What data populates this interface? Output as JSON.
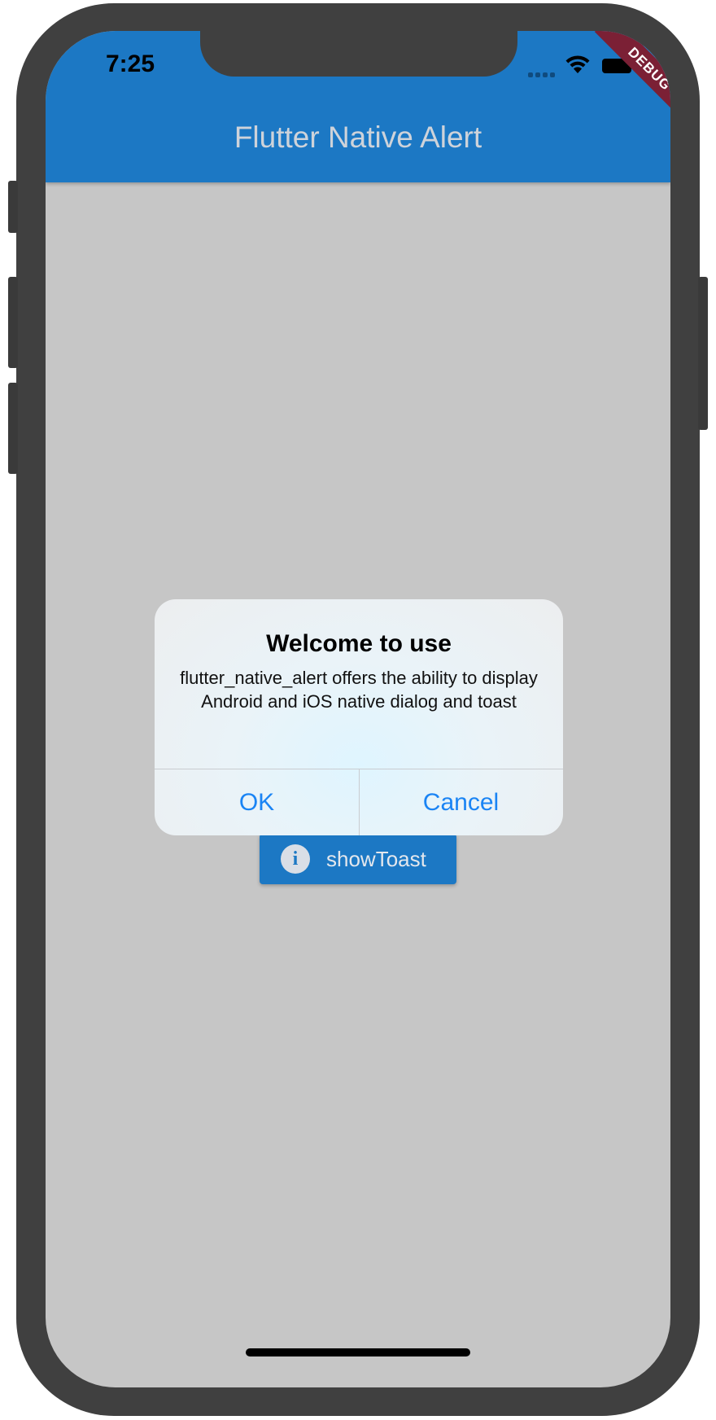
{
  "status_bar": {
    "time": "7:25"
  },
  "app_bar": {
    "title": "Flutter Native Alert",
    "color": "#1c78c4"
  },
  "debug_banner": {
    "label": "DEBUG"
  },
  "alert": {
    "title": "Welcome to use",
    "message": "flutter_native_alert offers the ability to display Android and iOS native dialog and toast",
    "ok_label": "OK",
    "cancel_label": "Cancel",
    "button_color": "#1a84f4"
  },
  "toast_button": {
    "icon": "info-icon",
    "label": "showToast"
  },
  "icons": [
    "signal-icon",
    "wifi-icon",
    "battery-icon",
    "info-icon"
  ]
}
